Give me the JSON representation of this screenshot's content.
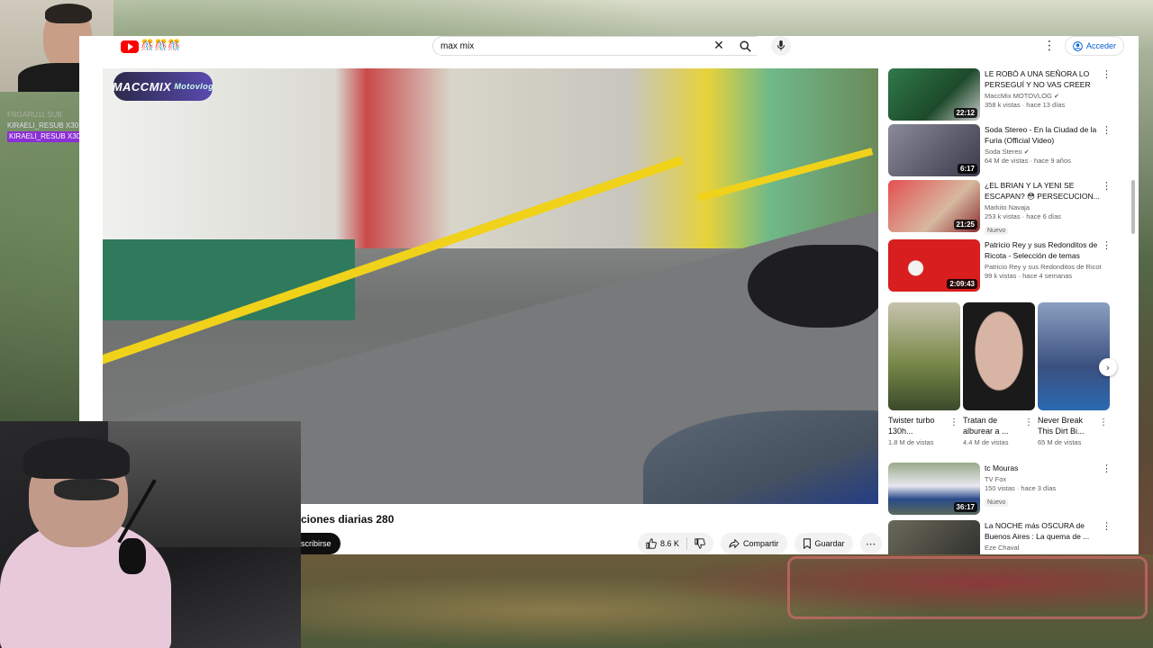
{
  "search": {
    "query": "max mix"
  },
  "header": {
    "yt_emoji": "🎊🎊🎊",
    "login_label": "Acceder"
  },
  "player": {
    "channel_logo_text": "MACCMIX",
    "channel_logo_sub": "Motovlog"
  },
  "video": {
    "title": "ciones diarias 280",
    "subscribe_label": "scribirse",
    "likes": "8.6 K",
    "share_label": "Compartir",
    "save_label": "Guardar"
  },
  "chat": {
    "lines": [
      "FNGARU11  SUB",
      "KIRAELI_RESUB X30",
      "KIRAELI_RESUB X30"
    ]
  },
  "sidebar": {
    "videos": [
      {
        "title": "LE ROBÓ A UNA SEÑORA LO PERSEGUÍ Y NO VAS CREER E...",
        "channel": "MaccMix MOTOVLOG",
        "verified": true,
        "meta": "358 k vistas · hace 13 días",
        "duration": "22:12",
        "badge": "",
        "thumb_color": "#2a6a40"
      },
      {
        "title": "Soda Stereo - En la Ciudad de la Furia (Official Video)",
        "channel": "Soda Stereo",
        "verified": true,
        "meta": "64 M de vistas · hace 9 años",
        "duration": "6:17",
        "badge": "",
        "thumb_color": "#5a5a6a"
      },
      {
        "title": "¿EL BRIAN Y LA YENI SE ESCAPAN? 😳 PERSECUCION...",
        "channel": "Markito Navaja",
        "verified": false,
        "meta": "253 k vistas · hace 6 días",
        "duration": "21:25",
        "badge": "Nuevo",
        "thumb_color": "#c94040"
      },
      {
        "title": "Patricio Rey y sus Redonditos de Ricota - Selección de temas",
        "channel": "Patricio Rey y sus Redonditos de Ricota",
        "verified": true,
        "meta": "99 k vistas · hace 4 semanas",
        "duration": "2:09:43",
        "badge": "",
        "thumb_color": "#d81e1e"
      },
      {
        "title": "tc Mouras",
        "channel": "TV Fox",
        "verified": false,
        "meta": "150 vistas · hace 3 días",
        "duration": "36:17",
        "badge": "Nuevo",
        "thumb_color": "#3a5a8a"
      },
      {
        "title": "La NOCHE más OSCURA de Buenos Aires : La quema de ...",
        "channel": "Eze Chaval",
        "verified": false,
        "meta": "",
        "duration": "",
        "badge": "",
        "thumb_color": "#4a4a3a"
      }
    ],
    "shorts": [
      {
        "title": "Twister turbo 130h...",
        "views": "1.8 M de vistas",
        "thumb_color": "#6a7a4a"
      },
      {
        "title": "Tratan de alburear a ...",
        "views": "4.4 M de vistas",
        "thumb_color": "#2a2a2a"
      },
      {
        "title": "Never Break This Dirt Bi...",
        "views": "65 M de vistas",
        "thumb_color": "#3a4a6a"
      }
    ]
  },
  "colors": {
    "brand_red": "#ff0000",
    "link_blue": "#065fd4",
    "chat_highlight": "#8b2fd6"
  },
  "icons": {
    "search": "search-icon",
    "clear": "close-icon",
    "mic": "mic-icon",
    "more": "more-vert-icon",
    "account": "account-icon",
    "like": "thumb-up-icon",
    "dislike": "thumb-down-icon",
    "share": "share-icon",
    "save": "bookmark-icon",
    "next": "chevron-right-icon"
  }
}
